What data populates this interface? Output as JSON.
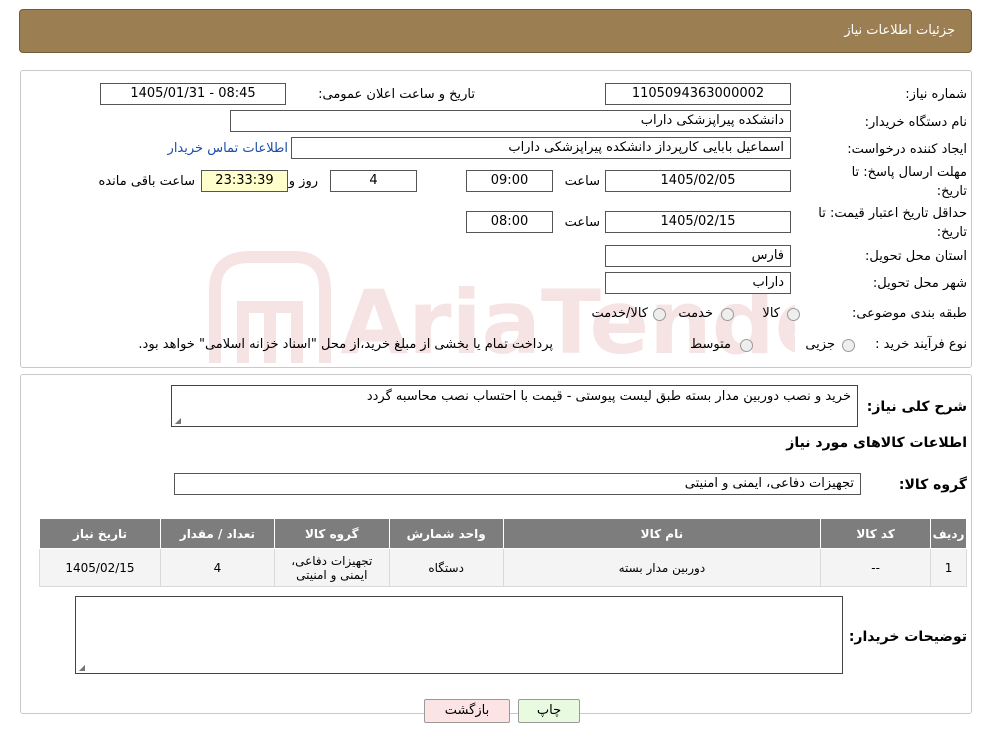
{
  "header": {
    "title": "جزئیات اطلاعات نیاز"
  },
  "form": {
    "need_number_label": "شماره نیاز:",
    "need_number": "1105094363000002",
    "announce_label": "تاریخ و ساعت اعلان عمومی:",
    "announce_value": "1405/01/31 - 08:45",
    "buyer_org_label": "نام دستگاه خریدار:",
    "buyer_org": "دانشکده پیراپزشکی داراب",
    "creator_label": "ایجاد کننده درخواست:",
    "creator": "اسماعیل بابایی کارپرداز دانشکده پیراپزشکی داراب",
    "contact_link": "اطلاعات تماس خریدار",
    "deadline_label_line1": "مهلت ارسال پاسخ: تا",
    "deadline_label_line2": "تاریخ:",
    "deadline_date": "1405/02/05",
    "time_label": "ساعت",
    "deadline_time": "09:00",
    "days_value": "4",
    "days_label": "روز و",
    "remaining_time": "23:33:39",
    "remaining_label": "ساعت باقی مانده",
    "validity_label_line1": "حداقل تاریخ اعتبار قیمت: تا",
    "validity_label_line2": "تاریخ:",
    "validity_date": "1405/02/15",
    "validity_time": "08:00",
    "province_label": "استان محل تحویل:",
    "province": "فارس",
    "city_label": "شهر محل تحویل:",
    "city": "داراب",
    "category_label": "طبقه بندی موضوعی:",
    "category_options": [
      "کالا",
      "خدمت",
      "کالا/خدمت"
    ],
    "process_label": "نوع فرآیند خرید :",
    "process_options": [
      "جزیی",
      "متوسط"
    ],
    "process_note": "پرداخت تمام یا بخشی از مبلغ خرید،از محل \"اسناد خزانه اسلامی\" خواهد بود."
  },
  "description": {
    "label": "شرح کلی نیاز:",
    "text": "خرید و نصب دوربین مدار بسته طبق لیست پیوستی - قیمت با احتساب نصب محاسبه گردد",
    "goods_info_title": "اطلاعات کالاهای مورد نیاز",
    "goods_group_label": "گروه کالا:",
    "goods_group": "تجهیزات دفاعی، ایمنی و امنیتی"
  },
  "table": {
    "headers": [
      "ردیف",
      "کد کالا",
      "نام کالا",
      "واحد شمارش",
      "گروه کالا",
      "تعداد / مقدار",
      "تاریخ نیاز"
    ],
    "rows": [
      [
        "1",
        "--",
        "دوربین مدار بسته",
        "دستگاه",
        "تجهیزات دفاعی، ایمنی و امنیتی",
        "4",
        "1405/02/15"
      ]
    ]
  },
  "buyer_notes": {
    "label": "توضیحات خریدار:",
    "text": ""
  },
  "buttons": {
    "print": "چاپ",
    "back": "بازگشت"
  },
  "watermark_text": "AriaTender.neT",
  "colors": {
    "header": "#9b7f52",
    "table_header": "#7d7d7d",
    "link": "#1c4fa8",
    "back_button": "#fde4e4",
    "print_button": "#e8fbe0"
  }
}
